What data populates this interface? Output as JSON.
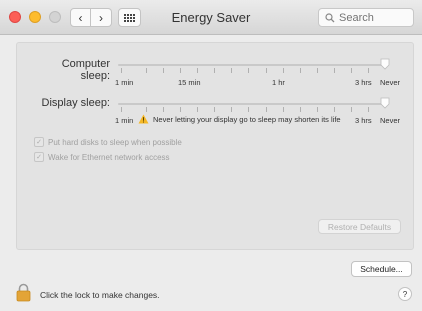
{
  "window": {
    "title": "Energy Saver"
  },
  "toolbar": {
    "back_icon": "‹",
    "forward_icon": "›",
    "search_placeholder": "Search"
  },
  "computer_sleep": {
    "label": "Computer sleep:",
    "tick_labels": {
      "t1": "1 min",
      "t2": "15 min",
      "t3": "1 hr",
      "t4": "3 hrs",
      "t5": "Never"
    },
    "value": "Never"
  },
  "display_sleep": {
    "label": "Display sleep:",
    "tick_labels": {
      "t1": "1 min",
      "t4": "3 hrs",
      "t5": "Never"
    },
    "warning": "Never letting your display go to sleep may shorten its life",
    "value": "Never"
  },
  "options": {
    "hard_disks": {
      "label": "Put hard disks to sleep when possible",
      "checked": true
    },
    "ethernet": {
      "label": "Wake for Ethernet network access",
      "checked": true
    }
  },
  "buttons": {
    "restore": "Restore Defaults",
    "schedule": "Schedule..."
  },
  "footer": {
    "lock_text": "Click the lock to make changes.",
    "help": "?"
  },
  "colors": {
    "warning": "#f5b826",
    "lock": "#e3a437",
    "close": "#fc5f57",
    "minimize": "#fdbc2e"
  }
}
